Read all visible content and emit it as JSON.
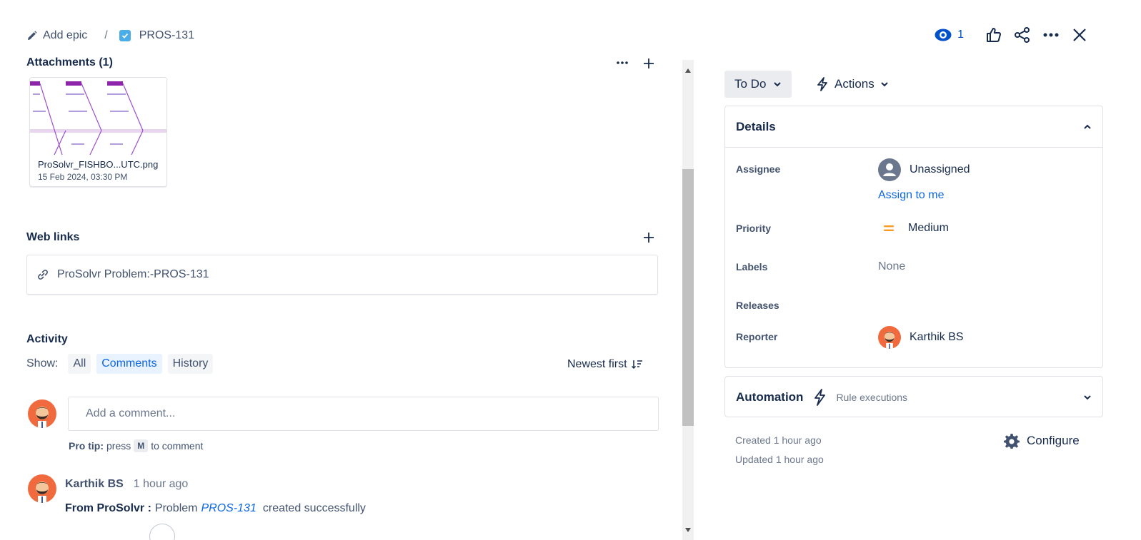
{
  "breadcrumb": {
    "add_epic": "Add epic",
    "separator": "/",
    "issue_key": "PROS-131"
  },
  "topbar": {
    "watch_count": "1"
  },
  "attachments": {
    "title": "Attachments (1)",
    "file_name": "ProSolvr_FISHBO...UTC.png",
    "file_date": "15 Feb 2024, 03:30 PM"
  },
  "web_links": {
    "title": "Web links",
    "link_text": "ProSolvr Problem:-PROS-131"
  },
  "activity": {
    "title": "Activity",
    "show_label": "Show:",
    "filters": [
      "All",
      "Comments",
      "History"
    ],
    "active_filter": "Comments",
    "sort_label": "Newest first",
    "comment_placeholder": "Add a comment...",
    "pro_tip_label": "Pro tip:",
    "pro_tip_press": "press",
    "pro_tip_key": "M",
    "pro_tip_suffix": "to comment",
    "comments": [
      {
        "author": "Karthik BS",
        "time": "1 hour ago",
        "prefix": "From ProSolvr :",
        "text_before": "Problem",
        "link": "PROS-131",
        "text_after": "created successfully"
      }
    ]
  },
  "status": {
    "current": "To Do",
    "actions_label": "Actions"
  },
  "details": {
    "title": "Details",
    "assignee_label": "Assignee",
    "assignee_value": "Unassigned",
    "assign_to_me": "Assign to me",
    "priority_label": "Priority",
    "priority_value": "Medium",
    "labels_label": "Labels",
    "labels_value": "None",
    "releases_label": "Releases",
    "reporter_label": "Reporter",
    "reporter_value": "Karthik BS"
  },
  "automation": {
    "title": "Automation",
    "rule_executions": "Rule executions"
  },
  "meta": {
    "created": "Created 1 hour ago",
    "updated": "Updated 1 hour ago",
    "configure": "Configure"
  },
  "colors": {
    "accent": "#0c66e4",
    "watch": "#0052cc",
    "priority_medium": "#ff991f",
    "issue_checkbox": "#4bade8",
    "avatar_bg": "#f06a3e"
  }
}
